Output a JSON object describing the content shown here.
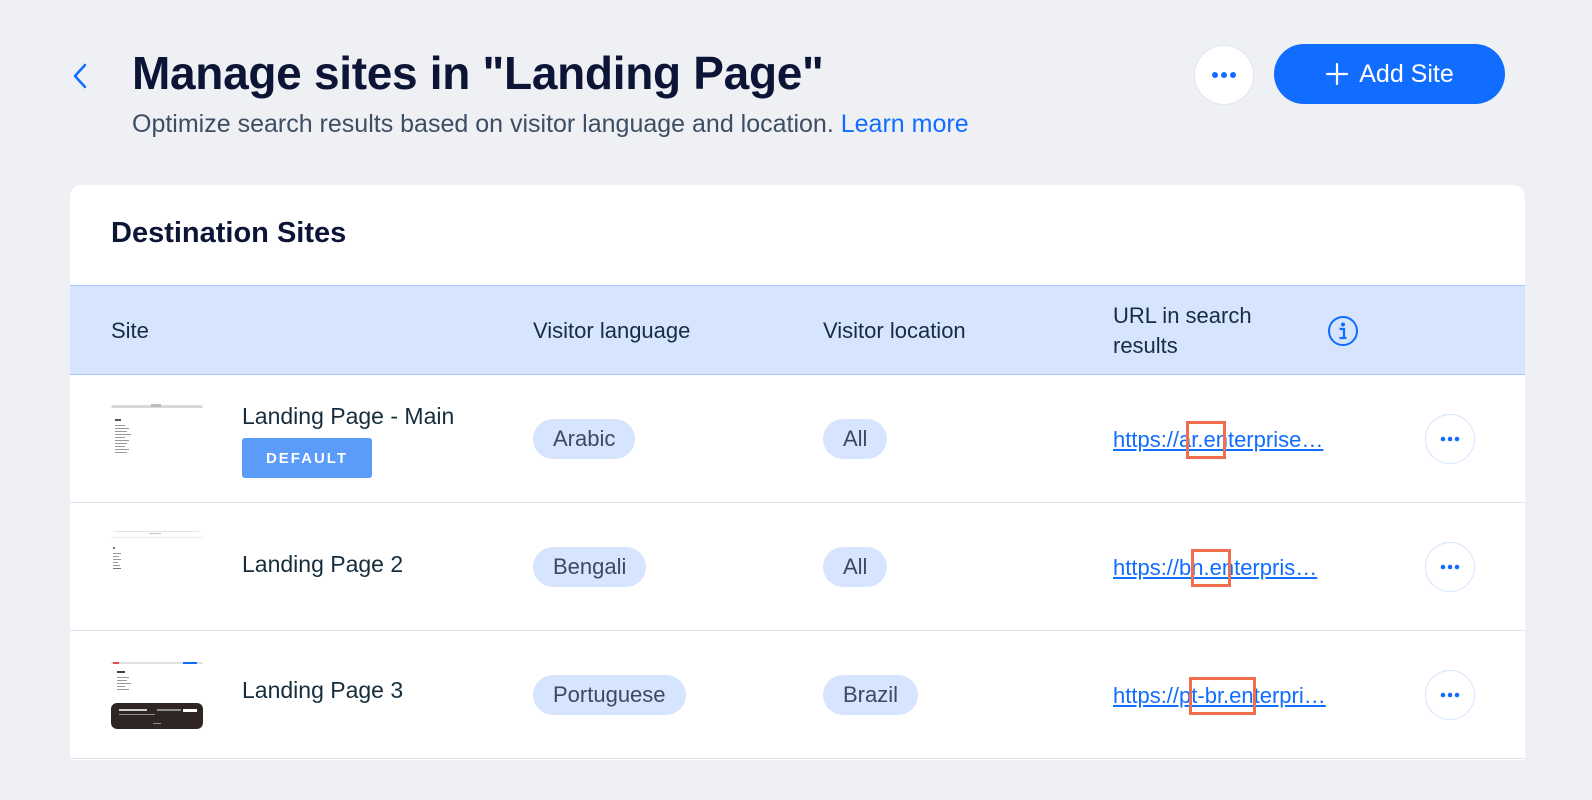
{
  "header": {
    "title": "Manage sites in \"Landing Page\"",
    "subtitle": "Optimize search results based on visitor language and location.",
    "learn_more": "Learn more",
    "add_site_label": "Add Site"
  },
  "card": {
    "title": "Destination Sites",
    "columns": {
      "site": "Site",
      "language": "Visitor language",
      "location": "Visitor location",
      "url": "URL in search results"
    },
    "rows": [
      {
        "name": "Landing Page - Main",
        "badge": "DEFAULT",
        "language": "Arabic",
        "location": "All",
        "url": "https://ar.enterprise…"
      },
      {
        "name": "Landing Page 2",
        "language": "Bengali",
        "location": "All",
        "url": "https://bn.enterpris…"
      },
      {
        "name": "Landing Page 3",
        "language": "Portuguese",
        "location": "Brazil",
        "url": "https://pt-br.enterpri…"
      }
    ]
  },
  "icons": {
    "back": "chevron-left-icon",
    "more": "more-horizontal-icon",
    "add": "plus-icon",
    "info": "info-icon"
  },
  "colors": {
    "accent": "#116dff",
    "highlight": "#f06e4e",
    "header_row": "#d6e4fe",
    "badge": "#5b9cfb"
  }
}
